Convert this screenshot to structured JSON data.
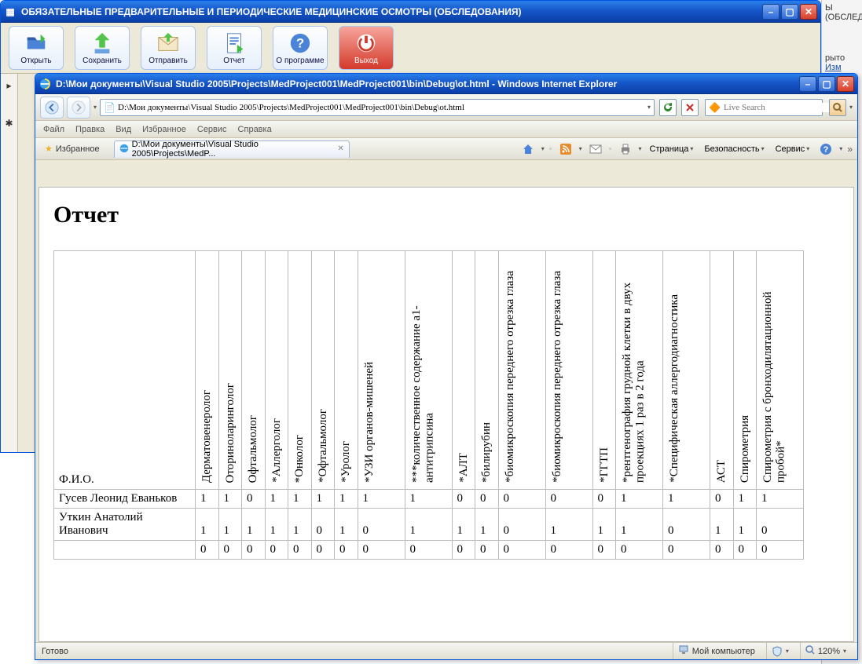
{
  "parent_window": {
    "title": "ОБЯЗАТЕЛЬНЫЕ ПРЕДВАРИТЕЛЬНЫЕ И ПЕРИОДИЧЕСКИЕ МЕДИЦИНСКИЕ ОСМОТРЫ (ОБСЛЕДОВАНИЯ)",
    "toolbar": {
      "open": "Открыть",
      "save": "Сохранить",
      "send": "Отправить",
      "report": "Отчет",
      "about": "О программе",
      "exit": "Выход"
    }
  },
  "right_strip": {
    "text1": "Ы (ОБСЛЕД",
    "text2": "рыто",
    "link": "Изм"
  },
  "ie_window": {
    "title": "D:\\Мои документы\\Visual Studio 2005\\Projects\\MedProject001\\MedProject001\\bin\\Debug\\ot.html - Windows Internet Explorer",
    "address": "D:\\Мои документы\\Visual Studio 2005\\Projects\\MedProject001\\MedProject001\\bin\\Debug\\ot.html",
    "search_placeholder": "Live Search",
    "menu": {
      "file": "Файл",
      "edit": "Правка",
      "view": "Вид",
      "favorites": "Избранное",
      "tools": "Сервис",
      "help": "Справка"
    },
    "favbar": {
      "favorites": "Избранное",
      "tab_title": "D:\\Мои документы\\Visual Studio 2005\\Projects\\MedP...",
      "page": "Страница",
      "security": "Безопасность",
      "service": "Сервис"
    },
    "status": {
      "ready": "Готово",
      "zone": "Мой компьютер",
      "zoom": "120%"
    }
  },
  "report": {
    "title": "Отчет",
    "fio_header": "Ф.И.О.",
    "columns": [
      "Дерматовенеролог",
      "Оториноларинголог",
      "Офтальмолог",
      "*Аллерголог",
      "*Онколог",
      "*Офтальмолог",
      "*Уролог",
      "*УЗИ органов-мишеней",
      "***количественное содержание a1-антитрипсина",
      "*АЛТ",
      "*билирубин",
      "*биомикроскопия переднего отрезка глаза",
      "*биомикроскопия переднего отрезка глаза",
      "*ГГТП",
      "*рентгенография грудной клетки в двух проекциях 1 раз в 2 года",
      "*Специфическая аллергодиагностика",
      "АСТ",
      "Спирометрия",
      "Спирометрия с бронходилятационной пробой*"
    ],
    "rows": [
      {
        "fio": "Гусев Леонид Еваньков",
        "vals": [
          1,
          1,
          0,
          1,
          1,
          1,
          1,
          1,
          1,
          0,
          0,
          0,
          0,
          0,
          1,
          1,
          0,
          1,
          1
        ]
      },
      {
        "fio": "Уткин Анатолий Иванович",
        "vals": [
          1,
          1,
          1,
          1,
          1,
          0,
          1,
          0,
          1,
          1,
          1,
          0,
          1,
          1,
          1,
          0,
          1,
          1,
          0
        ]
      },
      {
        "fio": "",
        "vals": [
          0,
          0,
          0,
          0,
          0,
          0,
          0,
          0,
          0,
          0,
          0,
          0,
          0,
          0,
          0,
          0,
          0,
          0,
          0
        ]
      }
    ]
  }
}
